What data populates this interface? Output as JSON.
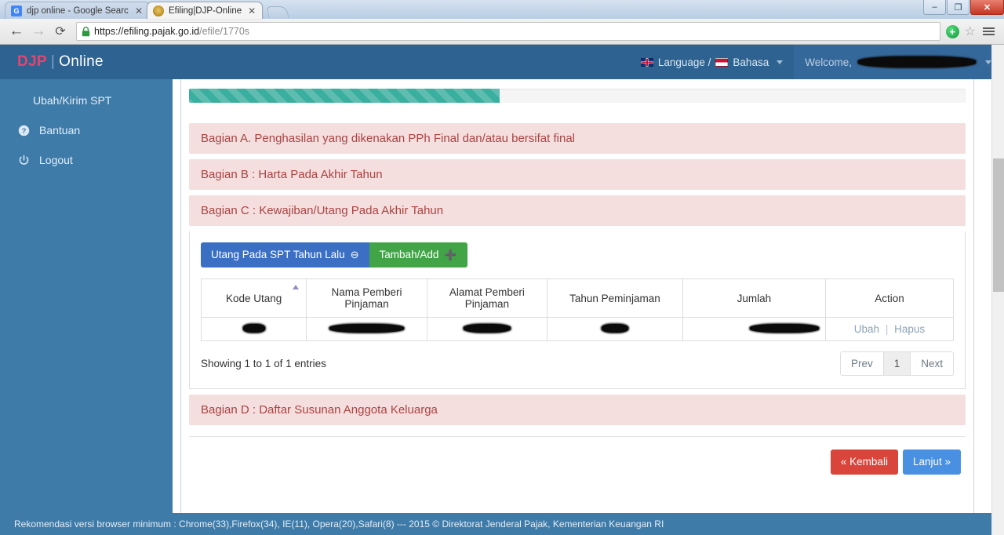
{
  "browser": {
    "tabs": [
      {
        "title": "djp online - Google Search",
        "favicon": "google-icon",
        "favicon_text": "G",
        "active": false
      },
      {
        "title": "Efiling|DJP-Online",
        "favicon": "djp-icon",
        "favicon_text": "",
        "active": true
      }
    ],
    "close_glyph": "✕",
    "nav": {
      "back": "←",
      "forward": "→",
      "reload": "⟳",
      "lock_icon": "lock-icon",
      "url_host": "https://efiling.pajak.go.id",
      "url_path": "/efile/1770s",
      "plus_badge": "+",
      "star": "☆",
      "menu": "hamburger-menu-icon"
    },
    "window_controls": {
      "minimize": "–",
      "maximize": "❐",
      "close": "✕"
    }
  },
  "header": {
    "brand_djp": "DJP",
    "brand_sep": "|",
    "brand_online": "Online",
    "language_label": "Language /",
    "bahasa_label": "Bahasa",
    "welcome_label": "Welcome,",
    "user_name_redacted": true
  },
  "sidebar": {
    "items": [
      {
        "label": "Ubah/Kirim SPT",
        "icon": "",
        "sub": true
      },
      {
        "label": "Bantuan",
        "icon": "question-circle-icon",
        "glyph": "❓",
        "sub": false
      },
      {
        "label": "Logout",
        "icon": "power-icon",
        "glyph": "⏻",
        "sub": false
      }
    ]
  },
  "main": {
    "progress_percent": 40,
    "sections": [
      {
        "id": "A",
        "title": "Bagian A. Penghasilan yang dikenakan PPh Final dan/atau bersifat final",
        "expanded": false
      },
      {
        "id": "B",
        "title": "Bagian B : Harta Pada Akhir Tahun",
        "expanded": false
      },
      {
        "id": "C",
        "title": "Bagian C : Kewajiban/Utang Pada Akhir Tahun",
        "expanded": true
      },
      {
        "id": "D",
        "title": "Bagian D : Daftar Susunan Anggota Keluarga",
        "expanded": false
      }
    ],
    "section_c": {
      "btn_prev_year": "Utang Pada SPT Tahun Lalu",
      "btn_prev_year_glyph": "⊖",
      "btn_add": "Tambah/Add",
      "btn_add_glyph": "➕",
      "table": {
        "columns": [
          {
            "label": "Kode Utang",
            "sorted": "asc"
          },
          {
            "label": "Nama Pemberi Pinjaman",
            "sorted": ""
          },
          {
            "label": "Alamat Pemberi Pinjaman",
            "sorted": ""
          },
          {
            "label": "Tahun Peminjaman",
            "sorted": ""
          },
          {
            "label": "Jumlah",
            "sorted": ""
          },
          {
            "label": "Action",
            "sorted": ""
          }
        ],
        "rows": [
          {
            "kode_utang": "",
            "nama_pemberi": "",
            "alamat_pemberi": "",
            "tahun_peminjaman": "",
            "jumlah": "",
            "redacted": true,
            "action_edit": "Ubah",
            "action_sep": "|",
            "action_delete": "Hapus"
          }
        ],
        "showing_text": "Showing 1 to 1 of 1 entries",
        "pagination": {
          "prev": "Prev",
          "pages": [
            "1"
          ],
          "next": "Next",
          "current": "1"
        }
      }
    },
    "form_actions": {
      "back_label": "« Kembali",
      "next_label": "Lanjut »"
    }
  },
  "footer": {
    "text": "Rekomendasi versi browser minimum : Chrome(33),Firefox(34), IE(11), Opera(20),Safari(8) --- 2015 © Direktorat Jenderal Pajak, Kementerian Keuangan RI",
    "scroll_top_glyph": "⌃"
  },
  "colors": {
    "header_blue": "#2d6291",
    "sidebar_blue": "#3f7ba8",
    "accent_pink": "#e8436f",
    "section_bg": "#f5dede",
    "section_text": "#a94442",
    "progress_teal": "#3aaf9f",
    "btn_blue": "#3a6fc4",
    "btn_green": "#41a548",
    "btn_red": "#d9453b",
    "btn_primary": "#4a90e2"
  }
}
